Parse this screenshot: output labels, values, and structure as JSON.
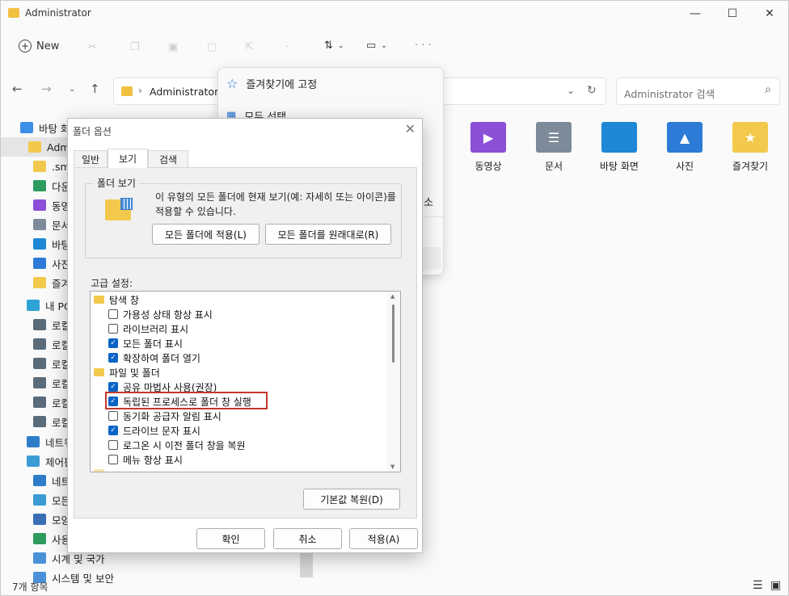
{
  "window": {
    "title": "Administrator",
    "minimize": "—",
    "maximize": "☐",
    "close": "✕"
  },
  "toolbar": {
    "new_label": "New",
    "sort_glyph": "⇅",
    "view_glyph": "▭",
    "more_glyph": "· · ·"
  },
  "addressbar": {
    "path": "Administrator",
    "separator": "›",
    "search_placeholder": "Administrator 검색"
  },
  "sidebar": {
    "items": [
      {
        "label": "바탕 화",
        "icon": "desktop-icon",
        "color": "#3d8ee8"
      },
      {
        "label": "Admi",
        "icon": "folder-icon",
        "color": "#f2c94c",
        "selected": true
      },
      {
        "label": ".sm",
        "icon": "folder-icon",
        "color": "#f2c94c"
      },
      {
        "label": "다운",
        "icon": "download-icon",
        "color": "#2e9b5f"
      },
      {
        "label": "동영",
        "icon": "video-icon",
        "color": "#8b4fd8"
      },
      {
        "label": "문서",
        "icon": "document-icon",
        "color": "#7d8a99"
      },
      {
        "label": "바탕",
        "icon": "desktop-icon",
        "color": "#1e88d6"
      },
      {
        "label": "사진",
        "icon": "pictures-icon",
        "color": "#2d7bd6"
      },
      {
        "label": "즐겨",
        "icon": "favorites-icon",
        "color": "#f2c94c"
      },
      {
        "label": "내 PC",
        "icon": "pc-icon",
        "color": "#2ea3d6"
      },
      {
        "label": "로컬",
        "icon": "drive-icon",
        "color": "#5a6b7a"
      },
      {
        "label": "로컬",
        "icon": "drive-icon",
        "color": "#5a6b7a"
      },
      {
        "label": "로컬",
        "icon": "drive-icon",
        "color": "#5a6b7a"
      },
      {
        "label": "로컬",
        "icon": "drive-icon",
        "color": "#5a6b7a"
      },
      {
        "label": "로컬",
        "icon": "drive-icon",
        "color": "#5a6b7a"
      },
      {
        "label": "로컬",
        "icon": "drive-icon",
        "color": "#5a6b7a"
      },
      {
        "label": "네트워",
        "icon": "network-icon",
        "color": "#2e7dc9"
      },
      {
        "label": "제어판",
        "icon": "control-panel-icon",
        "color": "#3a9bd5"
      },
      {
        "label": "네트",
        "icon": "network-icon",
        "color": "#2e7dc9"
      },
      {
        "label": "모든",
        "icon": "control-panel-icon",
        "color": "#3a9bd5"
      },
      {
        "label": "모양",
        "icon": "appearance-icon",
        "color": "#3a6fb5"
      },
      {
        "label": "사용",
        "icon": "user-icon",
        "color": "#2e9b5f"
      },
      {
        "label": "시계 및 국가",
        "icon": "clock-icon",
        "color": "#4a90d9"
      },
      {
        "label": "시스템 및 보안",
        "icon": "security-icon",
        "color": "#4a90d9"
      }
    ]
  },
  "files": [
    {
      "label": "동영상",
      "color": "#8b4fd8",
      "glyph": "▶"
    },
    {
      "label": "문서",
      "color": "#7d8a99",
      "glyph": "☰"
    },
    {
      "label": "바탕 화면",
      "color": "#1e88d6",
      "glyph": ""
    },
    {
      "label": "사진",
      "color": "#2d7bd6",
      "glyph": "▲"
    },
    {
      "label": "즐겨찾기",
      "color": "#f2c94c",
      "glyph": "★"
    }
  ],
  "context_menu": {
    "pin_label": "즐겨찾기에 고정",
    "select_all_label": "모두 선택",
    "partial_label": "소"
  },
  "status": {
    "count_label": "7개 항목"
  },
  "dialog": {
    "title": "폴더 옵션",
    "tabs": [
      "일반",
      "보기",
      "검색"
    ],
    "active_tab": "보기",
    "folder_view": {
      "label": "폴더 보기",
      "description": "이 유형의 모든 폴더에 현재 보기(예: 자세히 또는 아이콘)를 적용할 수 있습니다.",
      "apply_button": "모든 폴더에 적용(L)",
      "reset_button": "모든 폴더를 원래대로(R)"
    },
    "advanced_label": "고급 설정:",
    "tree": [
      {
        "type": "group",
        "label": "탐색 창"
      },
      {
        "type": "check",
        "label": "가용성 상태 항상 표시",
        "checked": false
      },
      {
        "type": "check",
        "label": "라이브러리 표시",
        "checked": false
      },
      {
        "type": "check",
        "label": "모든 폴더 표시",
        "checked": true
      },
      {
        "type": "check",
        "label": "확장하여 폴더 열기",
        "checked": true
      },
      {
        "type": "group",
        "label": "파일 및 폴더"
      },
      {
        "type": "check",
        "label": "공유 마법사 사용(권장)",
        "checked": true
      },
      {
        "type": "check",
        "label": "독립된 프로세스로 폴더 창 실행",
        "checked": true
      },
      {
        "type": "check",
        "label": "동기화 공급자 알림 표시",
        "checked": false
      },
      {
        "type": "check",
        "label": "드라이브 문자 표시",
        "checked": true
      },
      {
        "type": "check",
        "label": "로그온 시 이전 폴더 창을 복원",
        "checked": false
      },
      {
        "type": "check",
        "label": "메뉴 항상 표시",
        "checked": false
      }
    ],
    "restore_defaults_button": "기본값 복원(D)",
    "ok_button": "확인",
    "cancel_button": "취소",
    "apply_button": "적용(A)"
  }
}
